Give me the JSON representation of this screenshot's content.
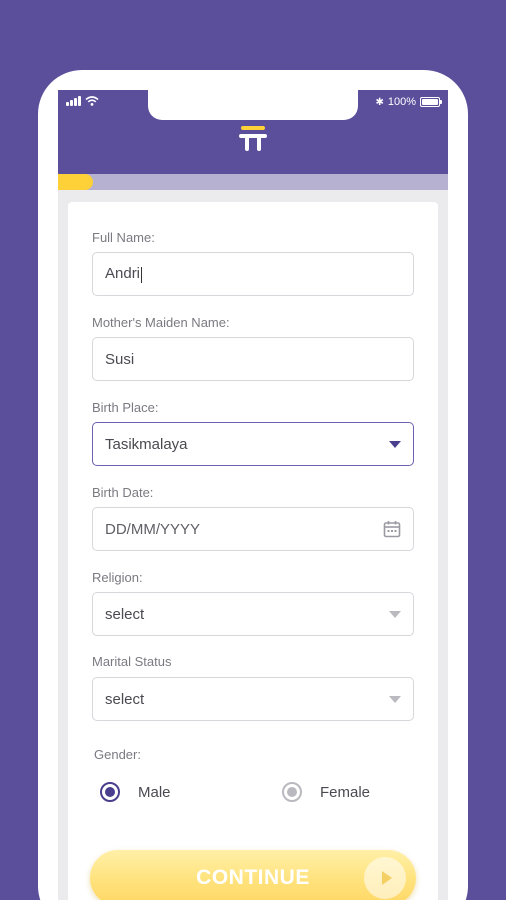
{
  "status_bar": {
    "battery_text": "100%",
    "bluetooth_glyph": "✱"
  },
  "progress": {
    "value": 0.09,
    "color": "#ffd139"
  },
  "colors": {
    "brand": "#5b4f9c",
    "accent": "#ffd139",
    "radio_active": "#4a3f8f"
  },
  "form": {
    "full_name": {
      "label": "Full Name:",
      "value": "Andri"
    },
    "maiden_name": {
      "label": "Mother's Maiden Name:",
      "value": "Susi"
    },
    "birth_place": {
      "label": "Birth Place:",
      "value": "Tasikmalaya"
    },
    "birth_date": {
      "label": "Birth Date:",
      "placeholder": "DD/MM/YYYY",
      "icon": "calendar-icon"
    },
    "religion": {
      "label": "Religion:",
      "value": "select"
    },
    "marital_status": {
      "label": "Marital Status",
      "value": "select"
    },
    "gender": {
      "label": "Gender:",
      "options": [
        {
          "label": "Male",
          "selected": true
        },
        {
          "label": "Female",
          "selected": false
        }
      ]
    }
  },
  "continue_button": {
    "label": "CONTINUE",
    "icon": "play-icon"
  }
}
